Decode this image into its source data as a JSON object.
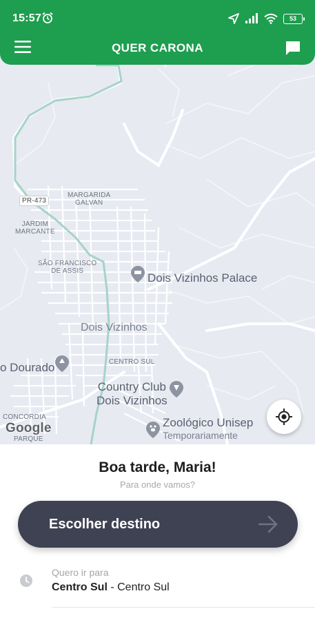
{
  "status_bar": {
    "time": "15:57",
    "battery": "53",
    "icons": [
      "alarm-icon",
      "location-arrow-icon",
      "signal-icon",
      "wifi-icon",
      "battery-icon"
    ]
  },
  "app_bar": {
    "title": "QUER CARONA",
    "menu_icon": "menu-icon",
    "chat_icon": "chat-icon",
    "accent_color": "#1e9e4f"
  },
  "map": {
    "labels": {
      "road_badge": "PR-473",
      "margarida_galvan": "MARGARIDA\nGALVAN",
      "jardim_marcante": "JARDIM\nMARCANTE",
      "sao_francisco": "SÃO FRANCISCO\nDE ASSIS",
      "dois_vizinhos_palace": "Dois Vizinhos Palace",
      "dois_vizinhos": "Dois Vizinhos",
      "centro_sul": "CENTRO SUL",
      "dourado": "o Dourado",
      "country_club": "Country Club\nDois Vizinhos",
      "zoologico": "Zoológico Unisep",
      "zoologico_sub": "Temporariamente",
      "concordia": "CONCORDIA",
      "parque": "PARQUE"
    },
    "attribution": "Google",
    "locate_icon": "my-location-icon"
  },
  "sheet": {
    "greeting": "Boa tarde, Maria!",
    "subtitle": "Para onde vamos?",
    "destination_button": "Escolher destino",
    "recent": {
      "label": "Quero ir para",
      "place_bold": "Centro Sul",
      "place_rest": " - Centro Sul"
    }
  }
}
